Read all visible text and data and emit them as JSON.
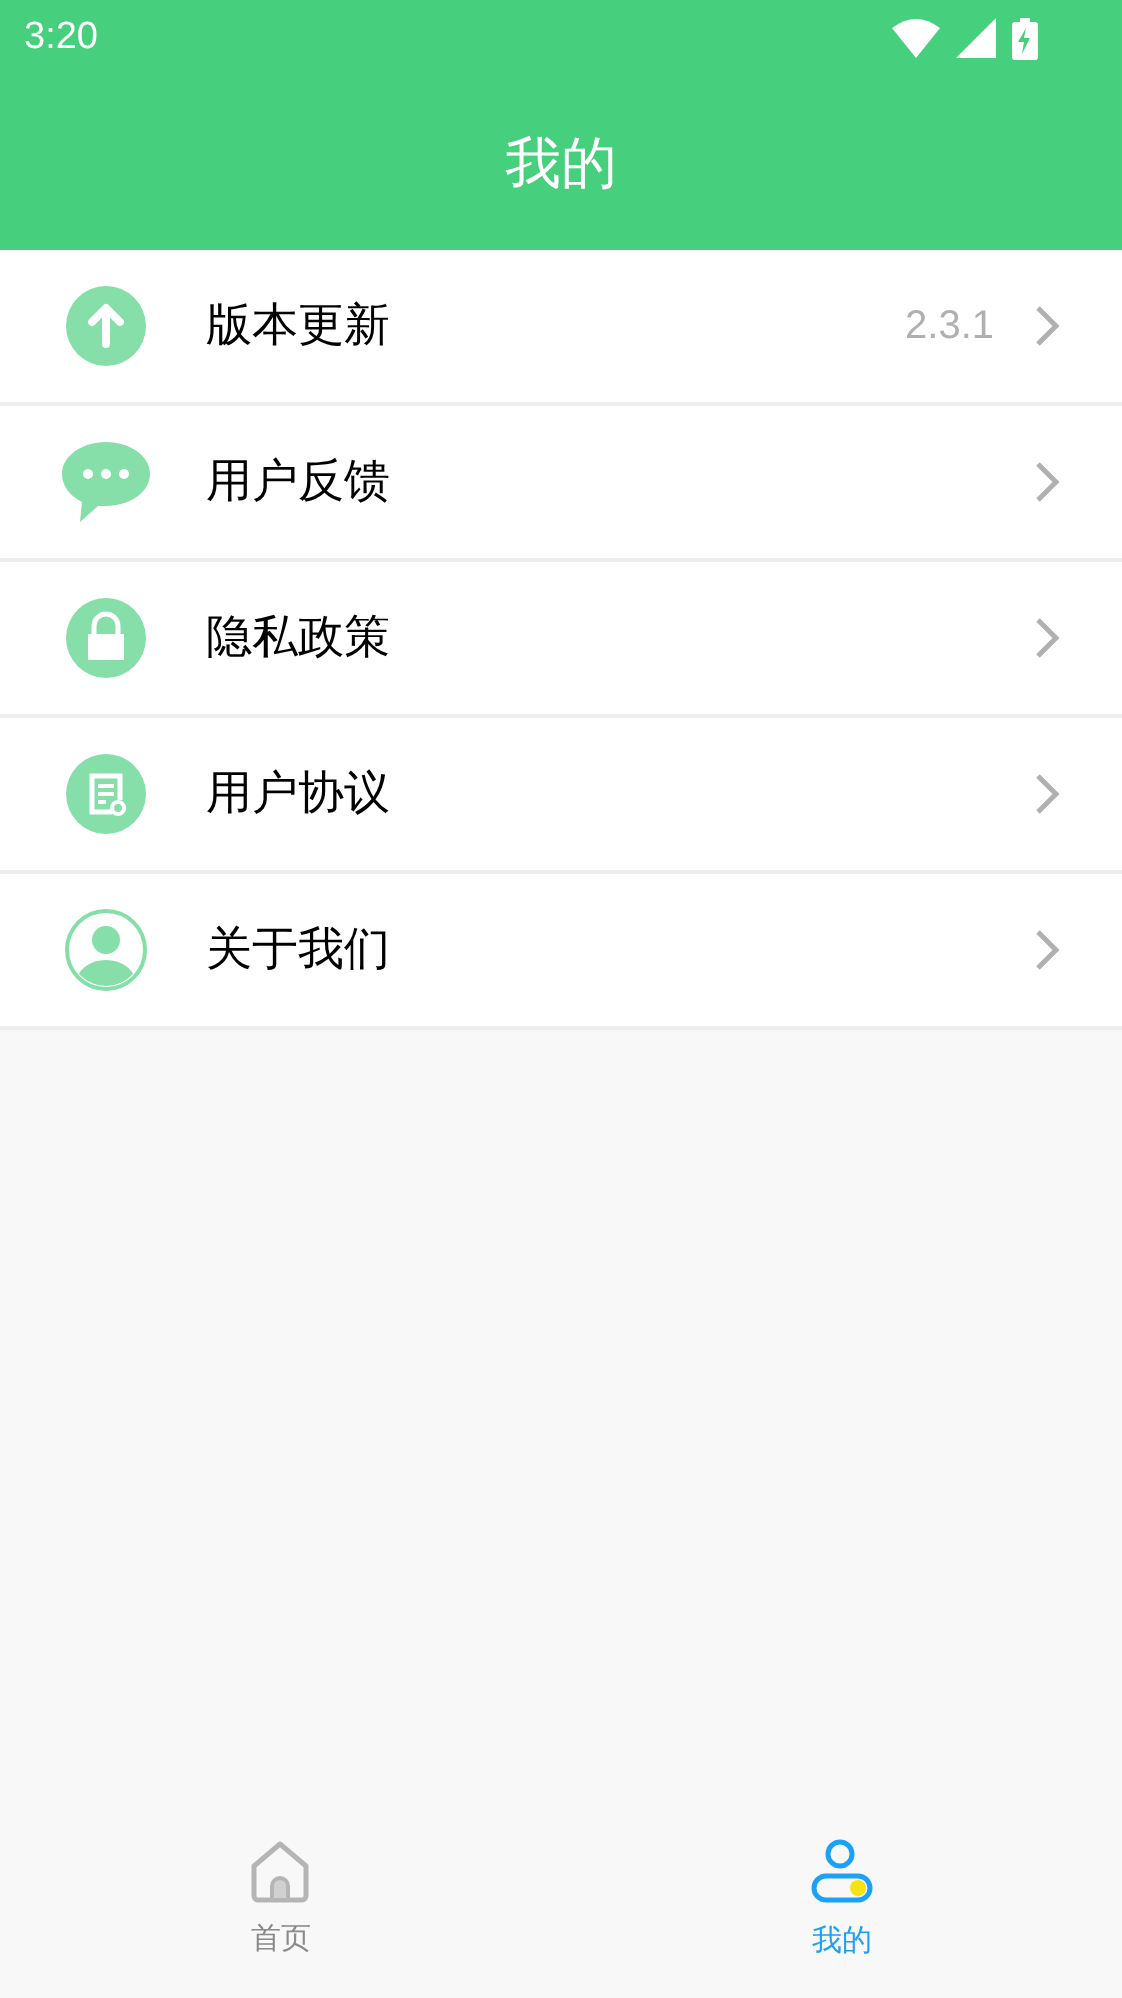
{
  "status_bar": {
    "time": "3:20"
  },
  "header": {
    "title": "我的"
  },
  "menu": [
    {
      "kind": "update",
      "label": "版本更新",
      "value": "2.3.1"
    },
    {
      "kind": "feedback",
      "label": "用户反馈"
    },
    {
      "kind": "privacy",
      "label": "隐私政策"
    },
    {
      "kind": "agreement",
      "label": "用户协议"
    },
    {
      "kind": "about",
      "label": "关于我们"
    }
  ],
  "tab_bar": [
    {
      "kind": "home",
      "label": "首页",
      "selected": false
    },
    {
      "kind": "profile",
      "label": "我的",
      "selected": true
    }
  ]
}
